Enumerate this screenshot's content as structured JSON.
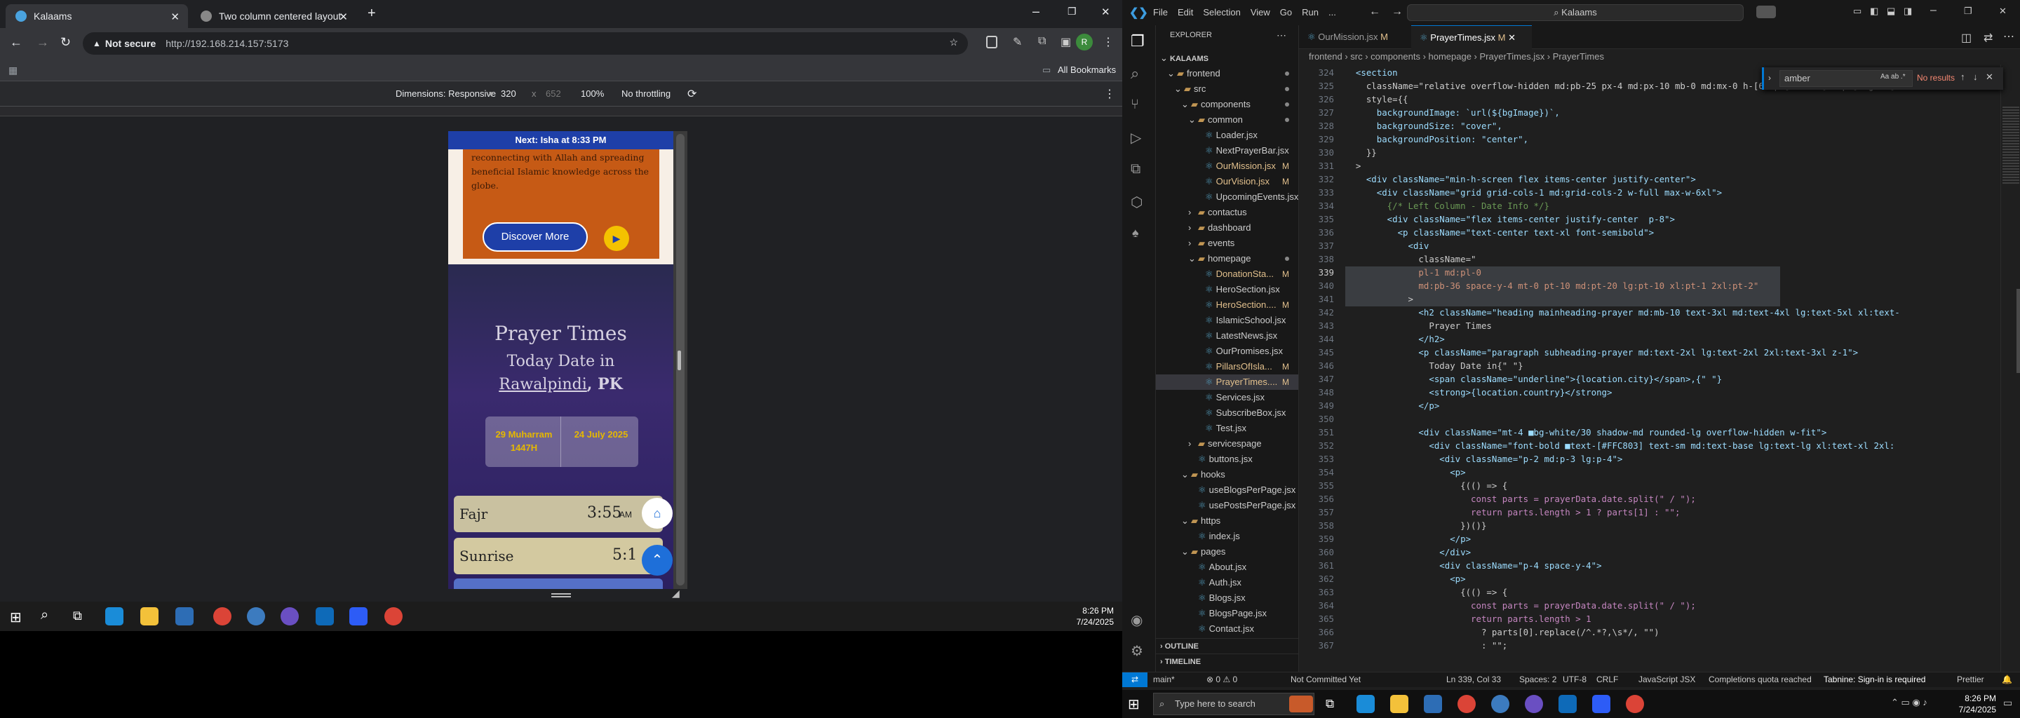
{
  "chrome": {
    "tabs": [
      {
        "label": "Kalaams"
      },
      {
        "label": "Two column centered layout"
      }
    ],
    "new_tab": "+",
    "not_secure": "Not secure",
    "url": "http://192.168.214.157:5173",
    "all_bookmarks": "All Bookmarks",
    "avatar_letter": "R",
    "devtools": {
      "dimensions_label": "Dimensions: Responsive",
      "width": "320",
      "x": "x",
      "height": "652",
      "zoom": "100%",
      "throttle": "No throttling"
    }
  },
  "phone": {
    "next_prayer": "Next: Isha at 8:33 PM",
    "hero_text_1": "reconnecting with Allah and spreading",
    "hero_text_2": "beneficial Islamic knowledge across the",
    "hero_text_3": "globe.",
    "discover": "Discover More",
    "title": "Prayer Times",
    "subtitle": "Today Date in",
    "city": "Rawalpindi",
    "country": ", PK",
    "hijri": "29 Muharram 1447H",
    "gregorian": "24 July 2025",
    "prayers": [
      {
        "name": "Fajr",
        "time": "3:55",
        "ampm": "AM"
      },
      {
        "name": "Sunrise",
        "time": "5:1"
      }
    ]
  },
  "taskbar_left": {
    "time": "8:26 PM",
    "date": "7/24/2025"
  },
  "vscode": {
    "menu": [
      "File",
      "Edit",
      "Selection",
      "View",
      "Go",
      "Run",
      "..."
    ],
    "search": "Kalaams",
    "explorer_title": "EXPLORER",
    "tree": [
      {
        "label": "KALAAMS",
        "indent": 0,
        "arrow": "⌄",
        "bold": true
      },
      {
        "label": "frontend",
        "indent": 1,
        "arrow": "⌄",
        "folder": true,
        "dot": true
      },
      {
        "label": "src",
        "indent": 2,
        "arrow": "⌄",
        "folder": true,
        "dot": true
      },
      {
        "label": "components",
        "indent": 3,
        "arrow": "⌄",
        "folder": true,
        "dot": true
      },
      {
        "label": "common",
        "indent": 4,
        "arrow": "⌄",
        "folder": true,
        "dot": true
      },
      {
        "label": "Loader.jsx",
        "indent": 5
      },
      {
        "label": "NextPrayerBar.jsx",
        "indent": 5
      },
      {
        "label": "OurMission.jsx",
        "indent": 5,
        "mark": "M"
      },
      {
        "label": "OurVision.jsx",
        "indent": 5,
        "mark": "M"
      },
      {
        "label": "UpcomingEvents.jsx",
        "indent": 5
      },
      {
        "label": "contactus",
        "indent": 4,
        "arrow": "›",
        "folder": true
      },
      {
        "label": "dashboard",
        "indent": 4,
        "arrow": "›",
        "folder": true
      },
      {
        "label": "events",
        "indent": 4,
        "arrow": "›",
        "folder": true
      },
      {
        "label": "homepage",
        "indent": 4,
        "arrow": "⌄",
        "folder": true,
        "dot": true
      },
      {
        "label": "DonationSta...",
        "indent": 5,
        "mark": "M"
      },
      {
        "label": "HeroSection.jsx",
        "indent": 5
      },
      {
        "label": "HeroSection....",
        "indent": 5,
        "mark": "M"
      },
      {
        "label": "IslamicSchool.jsx",
        "indent": 5
      },
      {
        "label": "LatestNews.jsx",
        "indent": 5
      },
      {
        "label": "OurPromises.jsx",
        "indent": 5
      },
      {
        "label": "PillarsOfIsla...",
        "indent": 5,
        "mark": "M"
      },
      {
        "label": "PrayerTimes....",
        "indent": 5,
        "mark": "M",
        "selected": true
      },
      {
        "label": "Services.jsx",
        "indent": 5
      },
      {
        "label": "SubscribeBox.jsx",
        "indent": 5
      },
      {
        "label": "Test.jsx",
        "indent": 5
      },
      {
        "label": "servicespage",
        "indent": 4,
        "arrow": "›",
        "folder": true
      },
      {
        "label": "buttons.jsx",
        "indent": 4
      },
      {
        "label": "hooks",
        "indent": 3,
        "arrow": "⌄",
        "folder": true
      },
      {
        "label": "useBlogsPerPage.jsx",
        "indent": 4
      },
      {
        "label": "usePostsPerPage.jsx",
        "indent": 4
      },
      {
        "label": "https",
        "indent": 3,
        "arrow": "⌄",
        "folder": true
      },
      {
        "label": "index.js",
        "indent": 4
      },
      {
        "label": "pages",
        "indent": 3,
        "arrow": "⌄",
        "folder": true
      },
      {
        "label": "About.jsx",
        "indent": 4
      },
      {
        "label": "Auth.jsx",
        "indent": 4
      },
      {
        "label": "Blogs.jsx",
        "indent": 4
      },
      {
        "label": "BlogsPage.jsx",
        "indent": 4
      },
      {
        "label": "Contact.jsx",
        "indent": 4
      }
    ],
    "outline": "OUTLINE",
    "timeline": "TIMELINE",
    "tabs": [
      {
        "label": "OurMission.jsx",
        "mark": "M"
      },
      {
        "label": "PrayerTimes.jsx",
        "mark": "M"
      }
    ],
    "breadcrumb": "frontend › src › components › homepage › PrayerTimes.jsx › PrayerTimes",
    "find_value": "amber",
    "find_result": "No results",
    "code_lines": [
      {
        "n": "324",
        "t": "  <section"
      },
      {
        "n": "325",
        "t": "    className=\"relative overflow-hidden md:pb-25 px-4 md:px-10 mb-0 md:mx-0 h-[630px] md:h-[580px] lg:h-[7"
      },
      {
        "n": "326",
        "t": "    style={{"
      },
      {
        "n": "327",
        "t": "      backgroundImage: `url(${bgImage})`,"
      },
      {
        "n": "328",
        "t": "      backgroundSize: \"cover\","
      },
      {
        "n": "329",
        "t": "      backgroundPosition: \"center\","
      },
      {
        "n": "330",
        "t": "    }}"
      },
      {
        "n": "331",
        "t": "  >"
      },
      {
        "n": "332",
        "t": "    <div className=\"min-h-screen flex items-center justify-center\">"
      },
      {
        "n": "333",
        "t": "      <div className=\"grid grid-cols-1 md:grid-cols-2 w-full max-w-6xl\">"
      },
      {
        "n": "334",
        "t": "        {/* Left Column - Date Info */}"
      },
      {
        "n": "335",
        "t": "        <div className=\"flex items-center justify-center  p-8\">"
      },
      {
        "n": "336",
        "t": "          <p className=\"text-center text-xl font-semibold\">"
      },
      {
        "n": "337",
        "t": "            <div"
      },
      {
        "n": "338",
        "t": "              className=\""
      },
      {
        "n": "339",
        "t": "              pl-1 md:pl-0"
      },
      {
        "n": "340",
        "t": "              md:pb-36 space-y-4 mt-0 pt-10 md:pt-20 lg:pt-10 xl:pt-1 2xl:pt-2\""
      },
      {
        "n": "341",
        "t": "            >"
      },
      {
        "n": "342",
        "t": "              <h2 className=\"heading mainheading-prayer md:mb-10 text-3xl md:text-4xl lg:text-5xl xl:text-"
      },
      {
        "n": "343",
        "t": "                Prayer Times"
      },
      {
        "n": "344",
        "t": "              </h2>"
      },
      {
        "n": "345",
        "t": "              <p className=\"paragraph subheading-prayer md:text-2xl lg:text-2xl 2xl:text-3xl z-1\">"
      },
      {
        "n": "346",
        "t": "                Today Date in{\" \"}"
      },
      {
        "n": "347",
        "t": "                <span className=\"underline\">{location.city}</span>,{\" \"}"
      },
      {
        "n": "348",
        "t": "                <strong>{location.country}</strong>"
      },
      {
        "n": "349",
        "t": "              </p>"
      },
      {
        "n": "350",
        "t": ""
      },
      {
        "n": "351",
        "t": "              <div className=\"mt-4 ■bg-white/30 shadow-md rounded-lg overflow-hidden w-fit\">"
      },
      {
        "n": "352",
        "t": "                <div className=\"font-bold ■text-[#FFC803] text-sm md:text-base lg:text-lg xl:text-xl 2xl:"
      },
      {
        "n": "353",
        "t": "                  <div className=\"p-2 md:p-3 lg:p-4\">"
      },
      {
        "n": "354",
        "t": "                    <p>"
      },
      {
        "n": "355",
        "t": "                      {(() => {"
      },
      {
        "n": "356",
        "t": "                        const parts = prayerData.date.split(\" / \");"
      },
      {
        "n": "357",
        "t": "                        return parts.length > 1 ? parts[1] : \"\";"
      },
      {
        "n": "358",
        "t": "                      })()}"
      },
      {
        "n": "359",
        "t": "                    </p>"
      },
      {
        "n": "360",
        "t": "                  </div>"
      },
      {
        "n": "361",
        "t": "                  <div className=\"p-4 space-y-4\">"
      },
      {
        "n": "362",
        "t": "                    <p>"
      },
      {
        "n": "363",
        "t": "                      {(() => {"
      },
      {
        "n": "364",
        "t": "                        const parts = prayerData.date.split(\" / \");"
      },
      {
        "n": "365",
        "t": "                        return parts.length > 1"
      },
      {
        "n": "366",
        "t": "                          ? parts[0].replace(/^.*?,\\s*/, \"\")"
      },
      {
        "n": "367",
        "t": "                          : \"\";"
      }
    ],
    "status": {
      "branch": "main*",
      "errors": "⊗ 0 ⚠ 0",
      "commit": "Not Committed Yet",
      "pos": "Ln 339, Col 33",
      "spaces": "Spaces: 2",
      "enc": "UTF-8",
      "eol": "CRLF",
      "lang": "JavaScript JSX",
      "copilot": "Completions quota reached",
      "tabnine": "Tabnine: Sign-in is required",
      "prettier": "Prettier"
    }
  },
  "taskbar_right": {
    "search_placeholder": "Type here to search",
    "time": "8:26 PM",
    "date": "7/24/2025"
  },
  "colors": {
    "accent": "#0078d4",
    "blue": "#1e3fa8",
    "gold": "#ffc803",
    "purple": "#3a2a6e",
    "chrome_bg": "#202124",
    "vscode_bg": "#1f1f1f"
  }
}
